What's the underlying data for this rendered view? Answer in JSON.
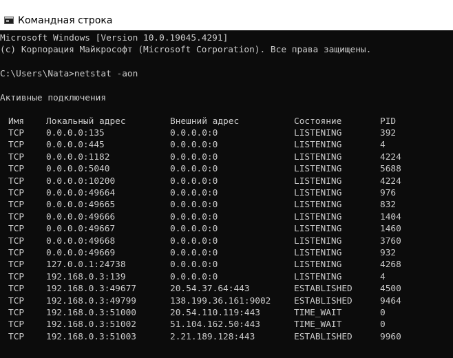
{
  "window": {
    "title": "Командная строка"
  },
  "console": {
    "header_lines": [
      "Microsoft Windows [Version 10.0.19045.4291]",
      "(c) Корпорация Майкрософт (Microsoft Corporation). Все права защищены.",
      "",
      "C:\\Users\\Nata>netstat -aon",
      "",
      "Активные подключения"
    ],
    "table": {
      "columns": [
        "Имя",
        "Локальный адрес",
        "Внешний адрес",
        "Состояние",
        "PID"
      ],
      "rows": [
        [
          "TCP",
          "0.0.0.0:135",
          "0.0.0.0:0",
          "LISTENING",
          "392"
        ],
        [
          "TCP",
          "0.0.0.0:445",
          "0.0.0.0:0",
          "LISTENING",
          "4"
        ],
        [
          "TCP",
          "0.0.0.0:1182",
          "0.0.0.0:0",
          "LISTENING",
          "4224"
        ],
        [
          "TCP",
          "0.0.0.0:5040",
          "0.0.0.0:0",
          "LISTENING",
          "5688"
        ],
        [
          "TCP",
          "0.0.0.0:10200",
          "0.0.0.0:0",
          "LISTENING",
          "4224"
        ],
        [
          "TCP",
          "0.0.0.0:49664",
          "0.0.0.0:0",
          "LISTENING",
          "976"
        ],
        [
          "TCP",
          "0.0.0.0:49665",
          "0.0.0.0:0",
          "LISTENING",
          "832"
        ],
        [
          "TCP",
          "0.0.0.0:49666",
          "0.0.0.0:0",
          "LISTENING",
          "1404"
        ],
        [
          "TCP",
          "0.0.0.0:49667",
          "0.0.0.0:0",
          "LISTENING",
          "1460"
        ],
        [
          "TCP",
          "0.0.0.0:49668",
          "0.0.0.0:0",
          "LISTENING",
          "3760"
        ],
        [
          "TCP",
          "0.0.0.0:49669",
          "0.0.0.0:0",
          "LISTENING",
          "932"
        ],
        [
          "TCP",
          "127.0.0.1:24738",
          "0.0.0.0:0",
          "LISTENING",
          "4268"
        ],
        [
          "TCP",
          "192.168.0.3:139",
          "0.0.0.0:0",
          "LISTENING",
          "4"
        ],
        [
          "TCP",
          "192.168.0.3:49677",
          "20.54.37.64:443",
          "ESTABLISHED",
          "4500"
        ],
        [
          "TCP",
          "192.168.0.3:49799",
          "138.199.36.161:9002",
          "ESTABLISHED",
          "9464"
        ],
        [
          "TCP",
          "192.168.0.3:51000",
          "20.54.110.119:443",
          "TIME_WAIT",
          "0"
        ],
        [
          "TCP",
          "192.168.0.3:51002",
          "51.104.162.50:443",
          "TIME_WAIT",
          "0"
        ],
        [
          "TCP",
          "192.168.0.3:51003",
          "2.21.189.128:443",
          "ESTABLISHED",
          "9960"
        ]
      ]
    }
  }
}
